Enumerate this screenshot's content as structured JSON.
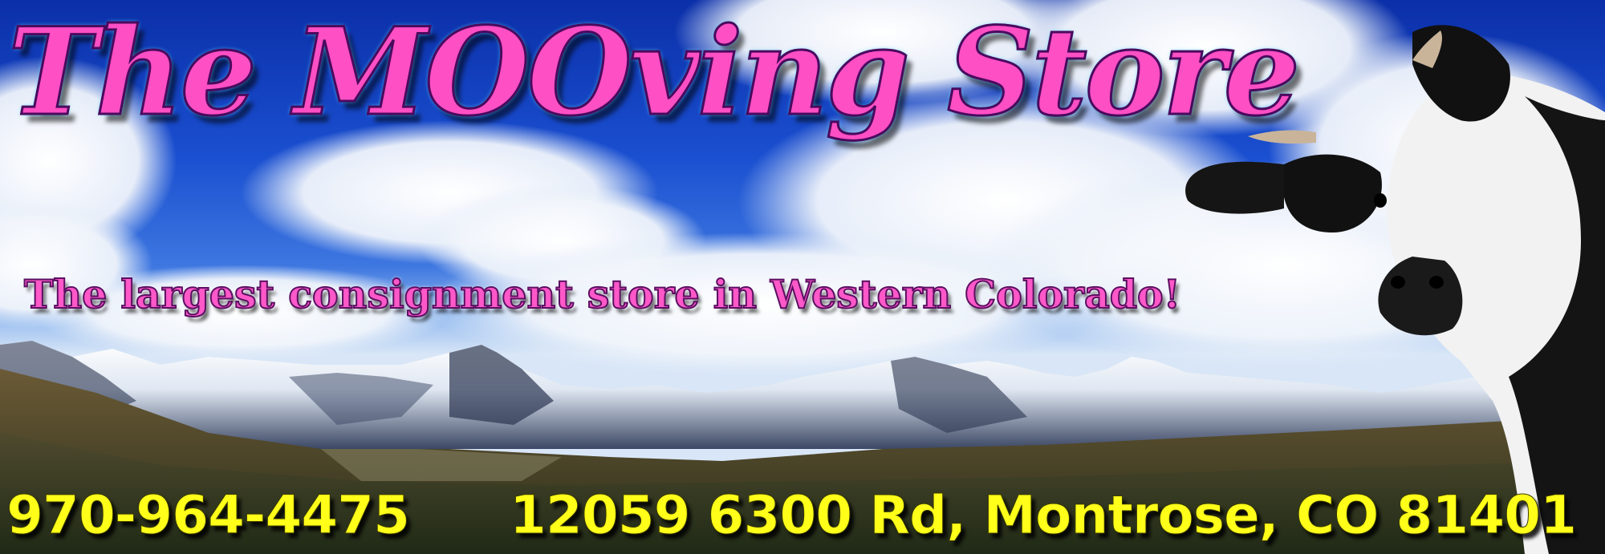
{
  "banner": {
    "title": "The MOOving Store",
    "tagline": "The largest consignment store in Western Colorado!",
    "phone": "970-964-4475",
    "address": "12059 6300 Rd, Montrose, CO 81401"
  },
  "colors": {
    "title": "#ff4fc4",
    "tagline": "#ff58c8",
    "contact_text": "#ffff1a",
    "sky": "#1a4fd0"
  }
}
